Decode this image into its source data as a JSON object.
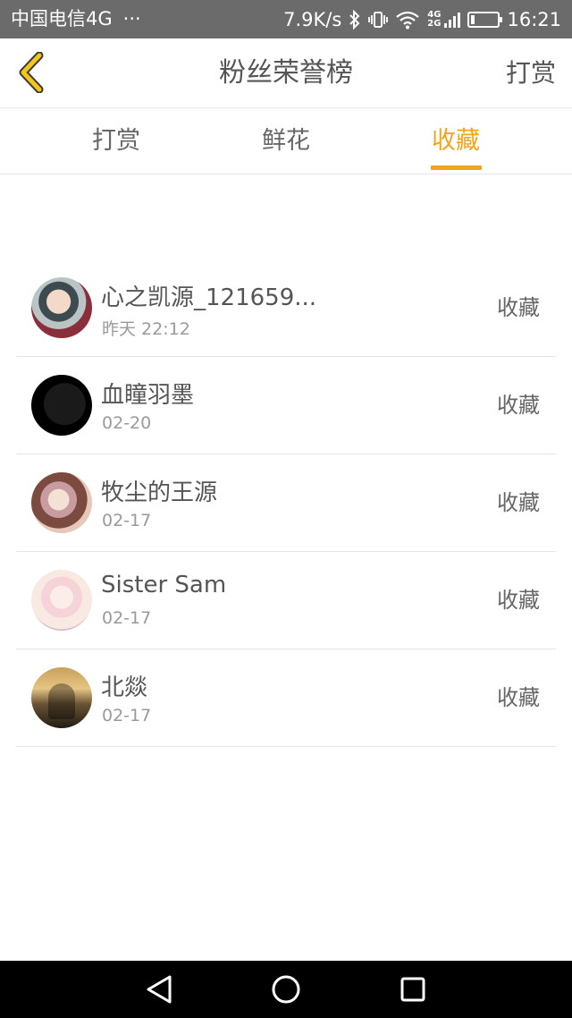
{
  "status_bar": {
    "carrier": "中国电信4G",
    "dots": "···",
    "speed": "7.9K/s",
    "net_top": "4G",
    "net_bottom": "2G",
    "time": "16:21",
    "battery_level": 0.15,
    "icons": [
      "bluetooth-icon",
      "vibrate-icon",
      "wifi-icon",
      "signal-icon",
      "battery-icon"
    ]
  },
  "nav": {
    "title": "粉丝荣誉榜",
    "action": "打赏",
    "back_icon": "chevron-left-icon",
    "accent_color": "#f1a51b"
  },
  "tabs": [
    {
      "label": "打赏",
      "active": false
    },
    {
      "label": "鲜花",
      "active": false
    },
    {
      "label": "收藏",
      "active": true
    }
  ],
  "fans": [
    {
      "name": "心之凯源_121659...",
      "time": "昨天 22:12",
      "type": "收藏"
    },
    {
      "name": "血瞳羽墨",
      "time": "02-20",
      "type": "收藏"
    },
    {
      "name": "牧尘的王源",
      "time": "02-17",
      "type": "收藏"
    },
    {
      "name": "Sister Sam",
      "time": "02-17",
      "type": "收藏"
    },
    {
      "name": "北燚",
      "time": "02-17",
      "type": "收藏"
    }
  ],
  "system_nav": {
    "icons": [
      "back-triangle-icon",
      "home-circle-icon",
      "recents-square-icon"
    ]
  }
}
